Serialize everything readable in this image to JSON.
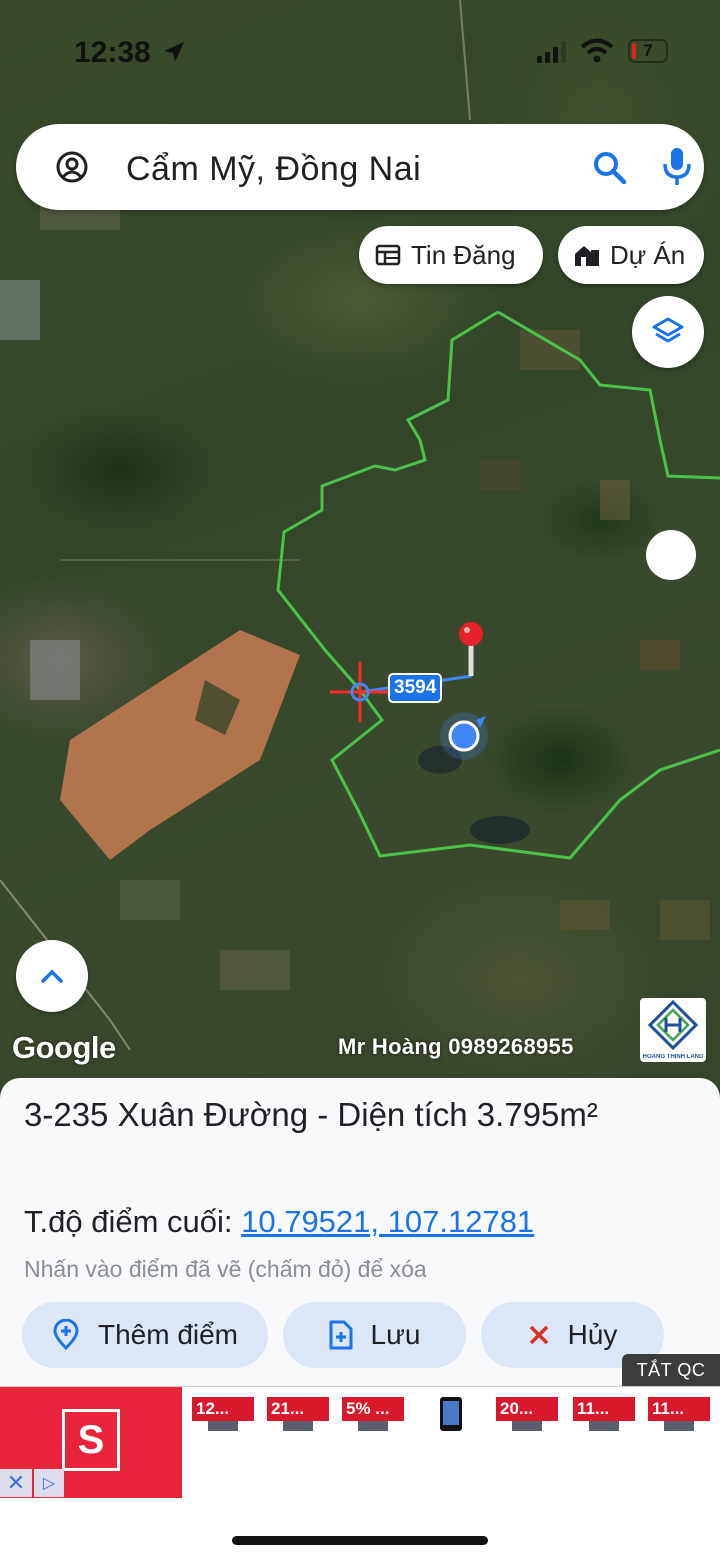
{
  "status_bar": {
    "time": "12:38",
    "battery": "7"
  },
  "search": {
    "query": "Cẩm Mỹ, Đồng Nai"
  },
  "chips": {
    "listings": "Tin Đăng",
    "projects": "Dự Án"
  },
  "map": {
    "distance_label": "3594",
    "google_attribution": "Google",
    "watermark": "Mr Hoàng 0989268955",
    "brand_logo_text": "HOÀNG THỊNH LAND",
    "boundary_color": "#4cc24a",
    "measure_color": "#ff2a2a",
    "location_dot_color": "#4285f4"
  },
  "panel": {
    "title": "3-235 Xuân Đường - Diện tích 3.795m²",
    "coords_label": "T.độ điểm cuối: ",
    "coords_value": "10.79521, 107.12781",
    "hint": "Nhấn vào điểm đã vẽ (chấm đỏ) để xóa",
    "buttons": {
      "add_point": "Thêm điểm",
      "save": "Lưu",
      "cancel": "Hủy"
    }
  },
  "ad": {
    "toggle_label": "TẮT QC",
    "deals": [
      "12...",
      "21...",
      "5% ...",
      "20...",
      "11...",
      "11..."
    ],
    "accent": "#e8233a"
  }
}
